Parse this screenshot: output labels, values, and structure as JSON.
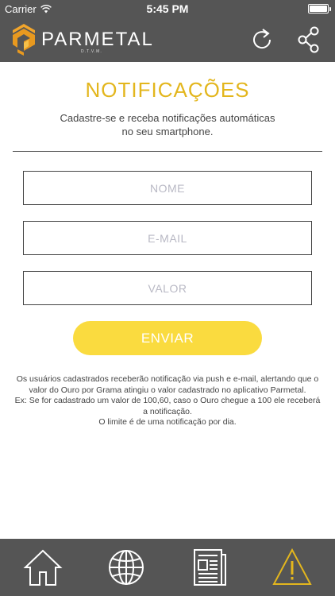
{
  "status_bar": {
    "carrier": "Carrier",
    "time": "5:45 PM",
    "icons": [
      "wifi-icon",
      "battery-icon"
    ]
  },
  "header": {
    "brand": "PARMETAL",
    "brand_sub": "D.T.V.M.",
    "icons": [
      "parmetal-logo",
      "refresh-icon",
      "share-icon"
    ]
  },
  "page": {
    "title": "NOTIFICAÇÕES",
    "subtitle_line1": "Cadastre-se e receba notificações automáticas",
    "subtitle_line2": "no seu smartphone."
  },
  "form": {
    "nome_placeholder": "NOME",
    "email_placeholder": "E-MAIL",
    "valor_placeholder": "VALOR",
    "submit_label": "ENVIAR"
  },
  "info": {
    "line1": "Os usuários cadastrados receberão notificação via push e e-mail, alertando que o valor do Ouro por Grama atingiu o valor cadastrado no aplicativo Parmetal.",
    "line2": "Ex: Se for cadastrado um valor de 100,60, caso o Ouro chegue a 100 ele receberá a notificação.",
    "line3": "O limite é de uma notificação por dia."
  },
  "tab_bar": {
    "tabs": [
      {
        "icon": "home-icon",
        "active": false
      },
      {
        "icon": "globe-icon",
        "active": false
      },
      {
        "icon": "newspaper-icon",
        "active": false
      },
      {
        "icon": "alert-icon",
        "active": true
      }
    ],
    "active_color": "#e3b61d",
    "inactive_color": "#ffffff"
  },
  "colors": {
    "accent": "#e3b61d",
    "button": "#fadb3f",
    "bars": "#555555"
  }
}
